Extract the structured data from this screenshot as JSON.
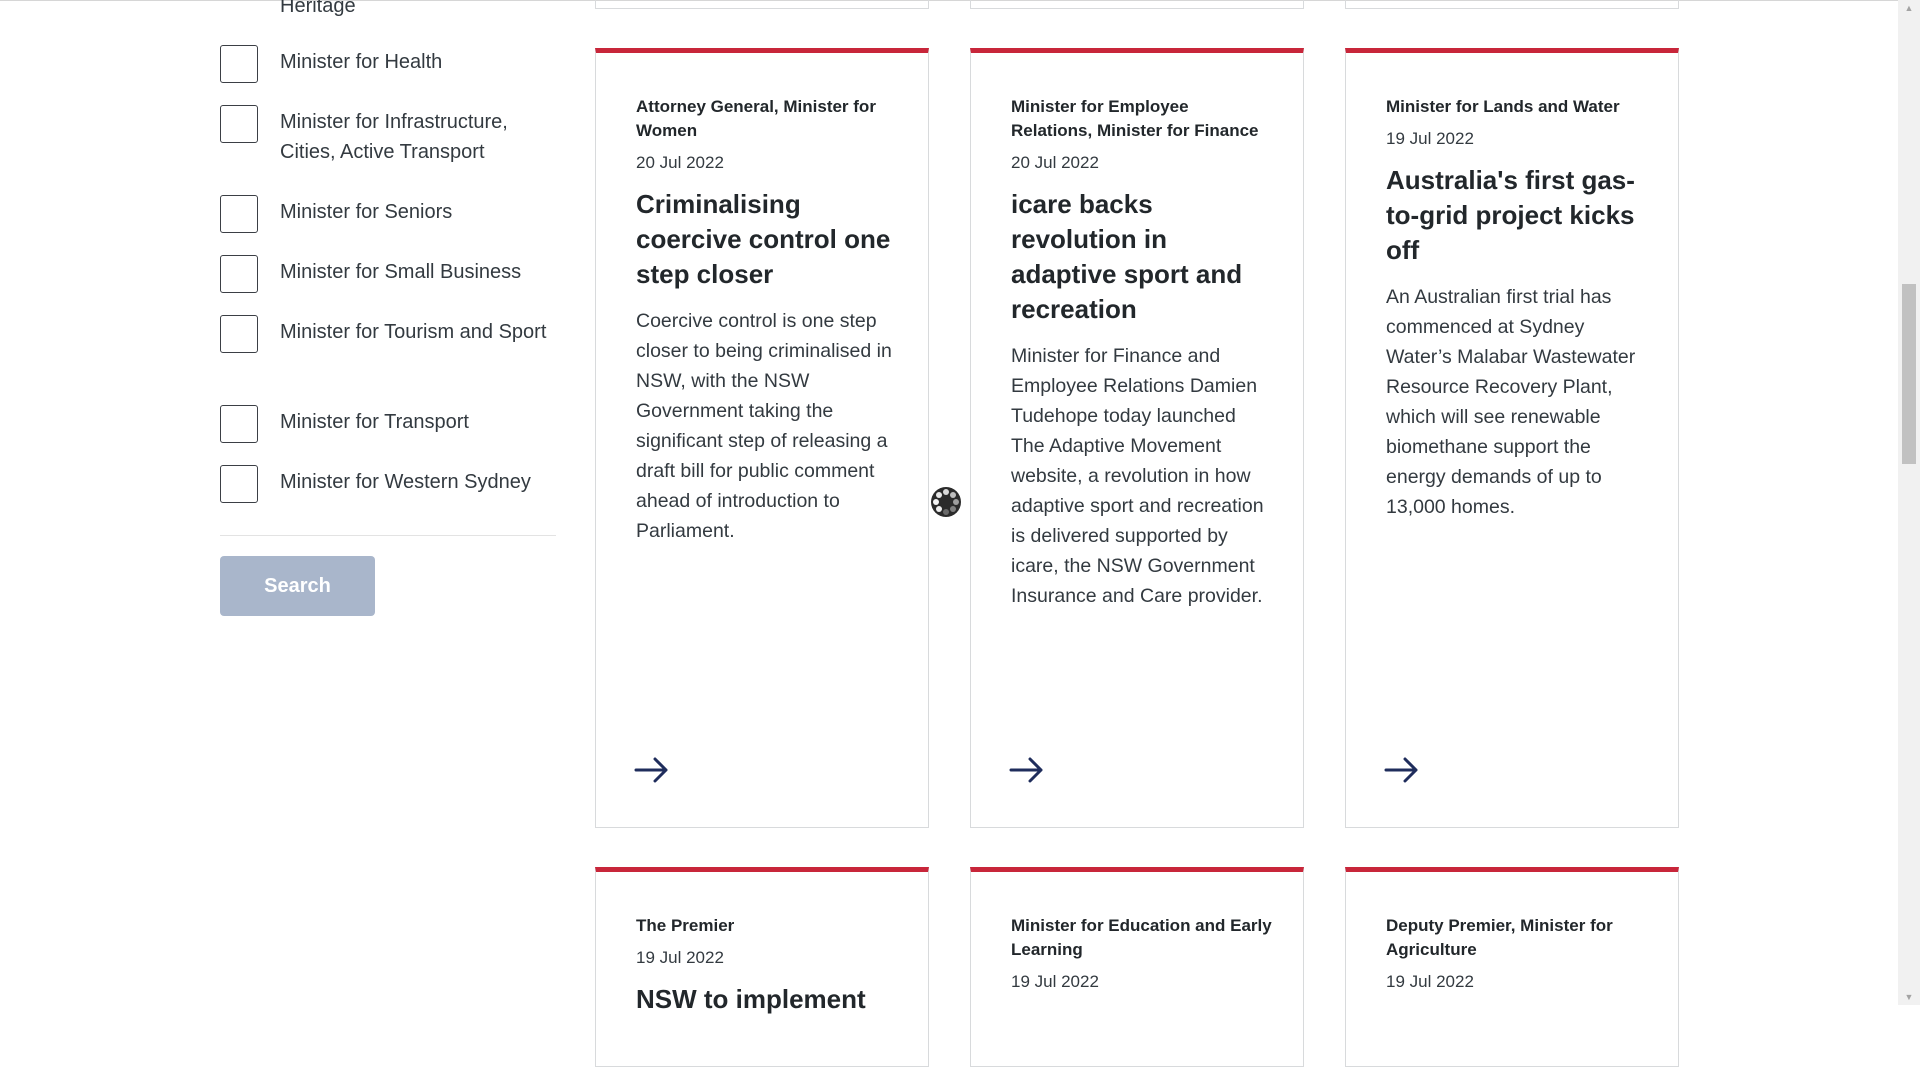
{
  "filters": {
    "partial_label": "Heritage",
    "items": [
      {
        "label": "Minister for Health",
        "checked": false
      },
      {
        "label": "Minister for Infrastructure, Cities, Active Transport",
        "checked": false
      },
      {
        "label": "Minister for Seniors",
        "checked": false
      },
      {
        "label": "Minister for Small Business",
        "checked": false
      },
      {
        "label": "Minister for Tourism and Sport",
        "checked": false
      },
      {
        "label": "Minister for Transport",
        "checked": false
      },
      {
        "label": "Minister for Western Sydney",
        "checked": false
      }
    ],
    "search_label": "Search"
  },
  "cards": [
    {
      "tag": "Attorney General, Minister for Women",
      "date": "20 Jul 2022",
      "title": "Criminalising coercive control one step closer",
      "summary": "Coercive control is one step closer to being criminalised in NSW, with the NSW Government taking the significant step of releasing a draft bill for public comment ahead of introduction to Parliament."
    },
    {
      "tag": "Minister for Employee Relations, Minister for Finance",
      "date": "20 Jul 2022",
      "title": "icare backs revolution in adaptive sport and recreation",
      "summary": "Minister for Finance and Employee Relations Damien Tudehope today launched The Adaptive Movement website, a revolution in how adaptive sport and recreation is delivered supported by icare, the NSW Government Insurance and Care provider."
    },
    {
      "tag": "Minister for Lands and Water",
      "date": "19 Jul 2022",
      "title": "Australia's first gas-to-grid project kicks off",
      "summary": "An Australian first trial has commenced at Sydney Water’s Malabar Wastewater Resource Recovery Plant, which will see renewable biomethane support the energy demands of up to 13,000 homes."
    },
    {
      "tag": "The Premier",
      "date": "19 Jul 2022",
      "title": "NSW to implement",
      "summary": ""
    },
    {
      "tag": "Minister for Education and Early Learning",
      "date": "19 Jul 2022",
      "title": "",
      "summary": ""
    },
    {
      "tag": "Deputy Premier, Minister for Agriculture",
      "date": "19 Jul 2022",
      "title": "",
      "summary": ""
    }
  ],
  "icons": {
    "arrow": "arrow-right-icon",
    "loader": "loading-spinner-icon"
  },
  "colors": {
    "accent": "#c8263a",
    "button_disabled": "#a9b6cb",
    "arrow": "#1f2d5c"
  }
}
